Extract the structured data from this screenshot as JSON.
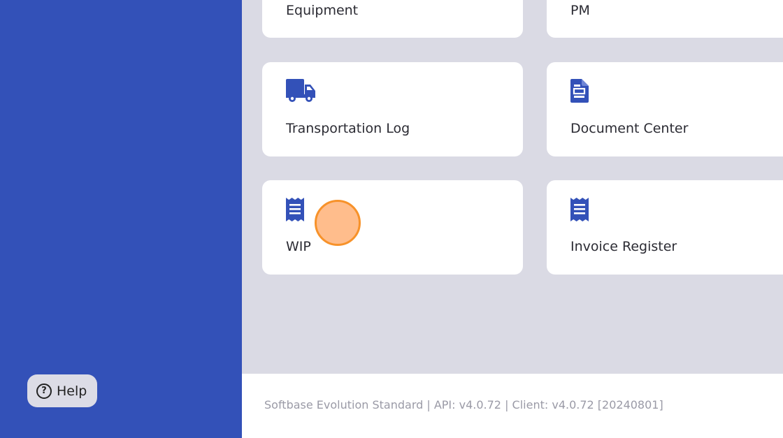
{
  "help": {
    "label": "Help",
    "icon": "help-circle-icon"
  },
  "cards": {
    "equipment": {
      "label": "Equipment"
    },
    "pm": {
      "label": "PM"
    },
    "transportation_log": {
      "label": "Transportation Log",
      "icon": "truck-icon"
    },
    "document_center": {
      "label": "Document Center",
      "icon": "document-icon"
    },
    "wip": {
      "label": "WIP",
      "icon": "receipt-icon"
    },
    "invoice_register": {
      "label": "Invoice Register",
      "icon": "receipt-icon"
    }
  },
  "footer": {
    "text": "Softbase Evolution Standard | API: v4.0.72 | Client: v4.0.72 [20240801]"
  },
  "colors": {
    "sidebar": "#3351b8",
    "accent": "#3351b8",
    "content_bg": "#dadae4",
    "card_bg": "#ffffff",
    "click_marker": "#f7922a"
  }
}
